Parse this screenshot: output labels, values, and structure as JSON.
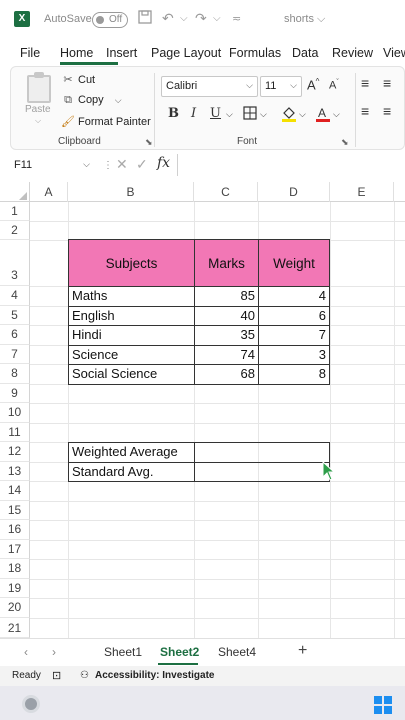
{
  "titlebar": {
    "logo": "X",
    "autosave_label": "AutoSave",
    "toggle_state": "Off",
    "doc_name": "shorts ⌵"
  },
  "ribbon_tabs": [
    "File",
    "Home",
    "Insert",
    "Page Layout",
    "Formulas",
    "Data",
    "Review",
    "View"
  ],
  "active_tab": "Home",
  "clipboard": {
    "paste_label": "Paste",
    "cut_label": "Cut",
    "copy_label": "Copy",
    "format_painter_label": "Format Painter",
    "group_label": "Clipboard"
  },
  "font": {
    "family": "Calibri",
    "size": "11",
    "bold": "B",
    "italic": "I",
    "underline": "U",
    "group_label": "Font"
  },
  "formula_bar": {
    "name_box": "F11",
    "fx": "fx",
    "content": ""
  },
  "columns": [
    "A",
    "B",
    "C",
    "D",
    "E"
  ],
  "rows": [
    "1",
    "2",
    "3",
    "4",
    "5",
    "6",
    "7",
    "8",
    "9",
    "10",
    "11",
    "12",
    "13",
    "14",
    "15",
    "16",
    "17",
    "18",
    "19",
    "20",
    "21"
  ],
  "table": {
    "headers": [
      "Subjects",
      "Marks",
      "Weight"
    ],
    "rows": [
      {
        "subject": "Maths",
        "marks": "85",
        "weight": "4"
      },
      {
        "subject": "English",
        "marks": "40",
        "weight": "6"
      },
      {
        "subject": "Hindi",
        "marks": "35",
        "weight": "7"
      },
      {
        "subject": "Science",
        "marks": "74",
        "weight": "3"
      },
      {
        "subject": "Social Science",
        "marks": "68",
        "weight": "8"
      }
    ],
    "header_color": "#f277b5"
  },
  "summary": {
    "weighted_label": "Weighted Average",
    "standard_label": "Standard Avg."
  },
  "sheets": [
    "Sheet1",
    "Sheet2",
    "Sheet4"
  ],
  "active_sheet": "Sheet2",
  "status": {
    "ready": "Ready",
    "accessibility": "Accessibility: Investigate"
  },
  "colors": {
    "excel_green": "#1d6f42",
    "font_color_red": "#e02020",
    "highlight_yellow": "#f5e000"
  }
}
